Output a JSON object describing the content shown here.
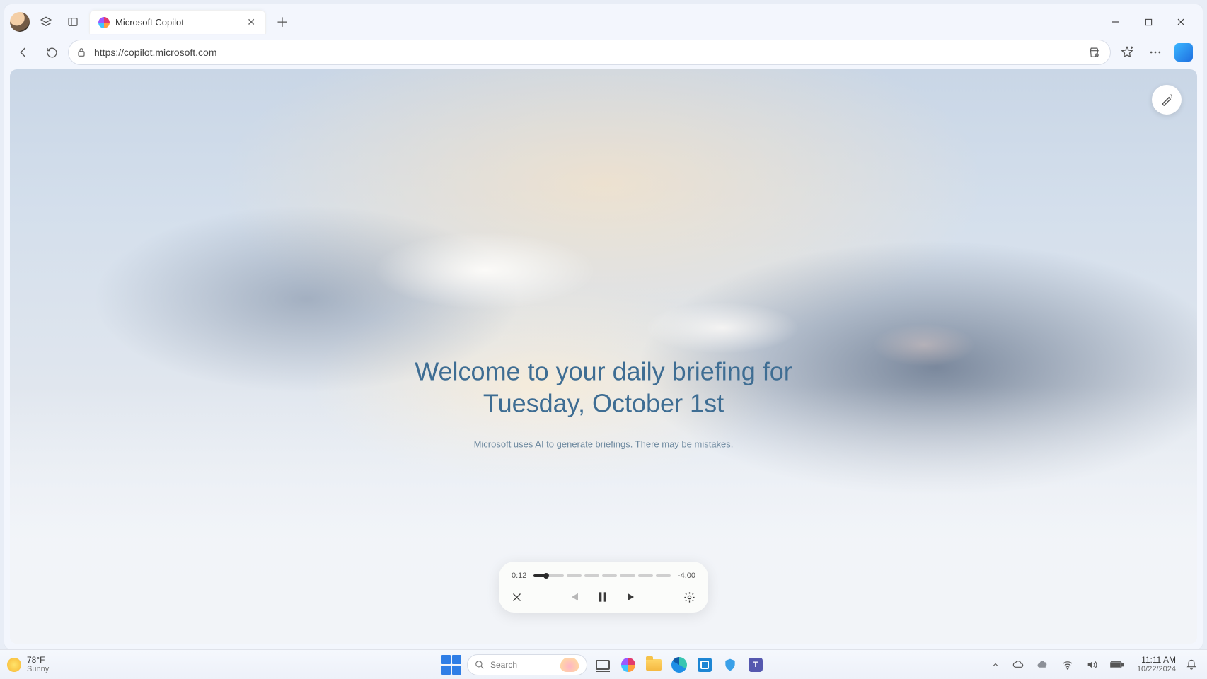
{
  "browser": {
    "tab": {
      "title": "Microsoft Copilot"
    },
    "url": "https://copilot.microsoft.com"
  },
  "page": {
    "headline_line1": "Welcome to your daily briefing for",
    "headline_line2": "Tuesday, October 1st",
    "disclaimer": "Microsoft uses AI to generate briefings. There may be mistakes."
  },
  "player": {
    "elapsed": "0:12",
    "remaining": "-4:00"
  },
  "taskbar": {
    "weather": {
      "temp": "78°F",
      "condition": "Sunny"
    },
    "search_placeholder": "Search",
    "clock": {
      "time": "11:11 AM",
      "date": "10/22/2024"
    }
  }
}
